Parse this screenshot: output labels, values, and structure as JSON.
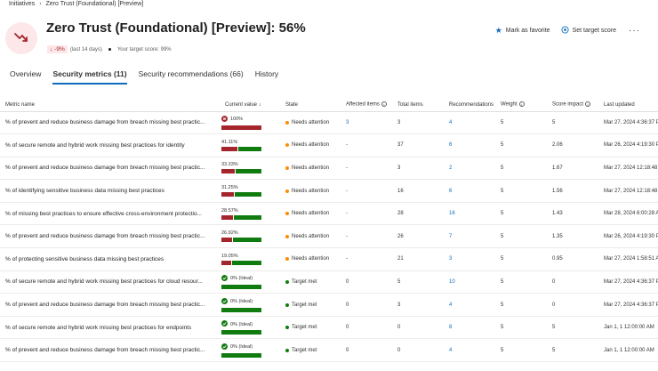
{
  "breadcrumb": {
    "root": "Initiatives",
    "current": "Zero Trust (Foundational) [Preview]"
  },
  "header": {
    "title": "Zero Trust (Foundational) [Preview]: 56%",
    "trend": "-9%",
    "trend_period": "(last 14 days)",
    "target_label": "Your target score: 99%",
    "icon": "trend-down-icon"
  },
  "actions": {
    "favorite": "Mark as favorite",
    "target": "Set target score",
    "more": "···"
  },
  "tabs": [
    "Overview",
    "Security metrics (11)",
    "Security recommendations (66)",
    "History"
  ],
  "active_tab": 1,
  "columns": [
    "Metric name",
    "Current value",
    "State",
    "Affected items",
    "Total items",
    "Recommendations",
    "Weight",
    "Score impact",
    "Last updated"
  ],
  "colors": {
    "needs_attention": "#ff8c00",
    "target_met": "#107c10",
    "bad": "#a4262c",
    "good": "#107c10",
    "link": "#0f6cbd"
  },
  "rows": [
    {
      "metric": "% of prevent and reduce business damage from breach missing best practic...",
      "value": "100%",
      "fraction": 1.0,
      "status": "bad",
      "state": "Needs attention",
      "affected": "3",
      "total": "3",
      "recs": "4",
      "weight": "5",
      "impact": "5",
      "updated": "Mar 27, 2024 4:36:37 PM"
    },
    {
      "metric": "% of secure remote and hybrid work missing best practices for identity",
      "value": "41.11%",
      "fraction": 0.4111,
      "status": "bad",
      "state": "Needs attention",
      "affected": "-",
      "total": "37",
      "recs": "6",
      "weight": "5",
      "impact": "2.06",
      "updated": "Mar 26, 2024 4:19:30 PM"
    },
    {
      "metric": "% of prevent and reduce business damage from breach missing best practic...",
      "value": "33.33%",
      "fraction": 0.3333,
      "status": "bad",
      "state": "Needs attention",
      "affected": "-",
      "total": "3",
      "recs": "2",
      "weight": "5",
      "impact": "1.67",
      "updated": "Mar 27, 2024 12:18:48 PM"
    },
    {
      "metric": "% of identifying sensitive business data missing best practices",
      "value": "31.25%",
      "fraction": 0.3125,
      "status": "bad",
      "state": "Needs attention",
      "affected": "-",
      "total": "16",
      "recs": "6",
      "weight": "5",
      "impact": "1.56",
      "updated": "Mar 27, 2024 12:18:48 PM"
    },
    {
      "metric": "% of missing best practices to ensure effective cross-environment protectio...",
      "value": "28.57%",
      "fraction": 0.2857,
      "status": "bad",
      "state": "Needs attention",
      "affected": "-",
      "total": "28",
      "recs": "16",
      "weight": "5",
      "impact": "1.43",
      "updated": "Mar 28, 2024 6:00:28 AM"
    },
    {
      "metric": "% of prevent and reduce business damage from breach missing best practic...",
      "value": "26.92%",
      "fraction": 0.2692,
      "status": "bad",
      "state": "Needs attention",
      "affected": "-",
      "total": "26",
      "recs": "7",
      "weight": "5",
      "impact": "1.35",
      "updated": "Mar 26, 2024 4:19:30 PM"
    },
    {
      "metric": "% of protecting sensitive business data missing best practices",
      "value": "19.05%",
      "fraction": 0.1905,
      "status": "bad",
      "state": "Needs attention",
      "affected": "-",
      "total": "21",
      "recs": "3",
      "weight": "5",
      "impact": "0.95",
      "updated": "Mar 27, 2024 1:58:51 AM"
    },
    {
      "metric": "% of secure remote and hybrid work missing best practices for cloud resour...",
      "value": "0% (Ideal)",
      "fraction": 0,
      "status": "good",
      "state": "Target met",
      "affected": "0",
      "total": "5",
      "recs": "10",
      "weight": "5",
      "impact": "0",
      "updated": "Mar 27, 2024 4:36:37 PM"
    },
    {
      "metric": "% of prevent and reduce business damage from breach missing best practic...",
      "value": "0% (Ideal)",
      "fraction": 0,
      "status": "good",
      "state": "Target met",
      "affected": "0",
      "total": "3",
      "recs": "4",
      "weight": "5",
      "impact": "0",
      "updated": "Mar 27, 2024 4:36:37 PM"
    },
    {
      "metric": "% of secure remote and hybrid work missing best practices for endpoints",
      "value": "0% (Ideal)",
      "fraction": 0,
      "status": "good",
      "state": "Target met",
      "affected": "0",
      "total": "0",
      "recs": "8",
      "weight": "5",
      "impact": "5",
      "updated": "Jan 1, 1 12:00:00 AM"
    },
    {
      "metric": "% of prevent and reduce business damage from breach missing best practic...",
      "value": "0% (Ideal)",
      "fraction": 0,
      "status": "good",
      "state": "Target met",
      "affected": "0",
      "total": "0",
      "recs": "4",
      "weight": "5",
      "impact": "5",
      "updated": "Jan 1, 1 12:00:00 AM"
    }
  ]
}
